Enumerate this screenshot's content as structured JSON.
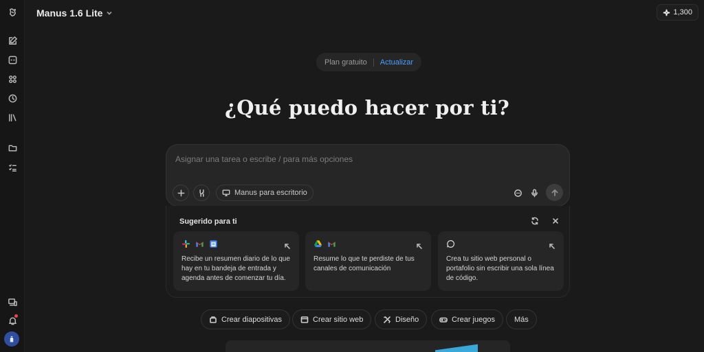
{
  "header": {
    "model_name": "Manus 1.6 Lite",
    "credits": "1,300"
  },
  "sidebar": {
    "items": [
      {
        "icon": "logo-icon"
      },
      {
        "icon": "new-task-icon"
      },
      {
        "icon": "agents-icon"
      },
      {
        "icon": "apps-icon"
      },
      {
        "icon": "history-icon"
      },
      {
        "icon": "library-icon"
      },
      {
        "icon": "folder-icon"
      },
      {
        "icon": "tasks-list-icon"
      }
    ],
    "bottom": [
      {
        "icon": "devices-icon"
      },
      {
        "icon": "bell-icon"
      },
      {
        "icon": "avatar"
      }
    ]
  },
  "plan": {
    "label": "Plan gratuito",
    "upgrade": "Actualizar"
  },
  "headline": "¿Qué puedo hacer por ti?",
  "composer": {
    "placeholder": "Asignar una tarea o escribe / para más opciones",
    "desktop_chip": "Manus para escritorio"
  },
  "suggestions": {
    "title": "Sugerido para ti",
    "cards": [
      {
        "logos": [
          "slack-logo",
          "gmail-logo",
          "calendar-logo"
        ],
        "text": "Recibe un resumen diario de lo que hay en tu bandeja de entrada y agenda antes de comenzar tu día."
      },
      {
        "logos": [
          "google-drive-logo",
          "gmail-logo"
        ],
        "text": "Resume lo que te perdiste de tus canales de comunicación"
      },
      {
        "logos": [
          "chat-bubble-icon"
        ],
        "text": "Crea tu sitio web personal o portafolio sin escribir una sola línea de código."
      }
    ]
  },
  "quick_actions": [
    {
      "label": "Crear diapositivas",
      "icon": "slides-icon"
    },
    {
      "label": "Crear sitio web",
      "icon": "website-icon"
    },
    {
      "label": "Diseño",
      "icon": "design-icon"
    },
    {
      "label": "Crear juegos",
      "icon": "gamepad-icon"
    },
    {
      "label": "Más",
      "icon": ""
    }
  ],
  "colors": {
    "background": "#1a1a1a",
    "accent": "#4a9eff",
    "notification": "#e5484d"
  }
}
